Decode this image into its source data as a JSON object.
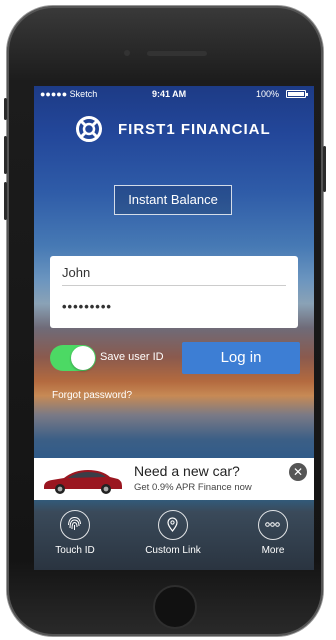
{
  "status": {
    "carrier": "●●●●● Sketch",
    "time": "9:41 AM",
    "battery": "100%"
  },
  "brand": {
    "name": "FIRST1 FINANCIAL",
    "icon": "life-ring-logo-icon"
  },
  "instant_balance": {
    "label": "Instant Balance"
  },
  "login": {
    "username_value": "John",
    "password_value": "•••••••••",
    "save_user_id_label": "Save user ID",
    "save_user_id_on": true,
    "login_label": "Log in",
    "forgot_label": "Forgot password?"
  },
  "ad": {
    "title": "Need a new car?",
    "subtitle": "Get 0.9% APR Finance now",
    "close": "✕"
  },
  "tabs": [
    {
      "label": "Touch ID",
      "icon": "fingerprint-icon"
    },
    {
      "label": "Custom Link",
      "icon": "location-pin-icon"
    },
    {
      "label": "More",
      "icon": "more-dots-icon"
    }
  ],
  "colors": {
    "accent": "#3d7ed4",
    "toggle_on": "#4cd964"
  }
}
